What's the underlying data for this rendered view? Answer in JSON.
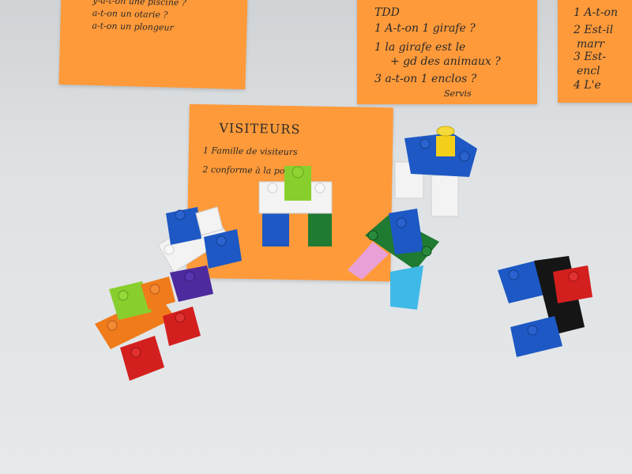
{
  "note_top_left": {
    "lines": [
      "y-a-t-on une piscine ?",
      "a-t-on un otarie ?",
      "a-t-on un plongeur"
    ]
  },
  "note_todo": {
    "header": "TDD",
    "lines": [
      "1 A-t-on 1 girafe ?",
      "1 la girafe est le",
      "+ gd des animaux ?",
      "3 a-t-on 1 enclos ?",
      "Servis"
    ]
  },
  "note_right": {
    "lines": [
      "1 A-t-on",
      "2 Est-il",
      "marr",
      "3 Est-",
      "encl",
      "4 L'e"
    ]
  },
  "note_visitors": {
    "title": "VISITEURS",
    "lines": [
      "1 Famille de visiteurs",
      "2 conforme à la police."
    ]
  },
  "colors": {
    "sticky": "#ff9a3a",
    "table": "#dfe2e4",
    "blue": "#1d58c4",
    "red": "#d41f1f",
    "green": "#1f7a32",
    "lime": "#88cf2d",
    "white": "#f3f3f3",
    "yellow": "#f4cf1a",
    "orange": "#f07b1b",
    "purple": "#4d2a9e",
    "cyan": "#3fb9e8",
    "pink": "#e9a0d6",
    "black": "#151515"
  }
}
